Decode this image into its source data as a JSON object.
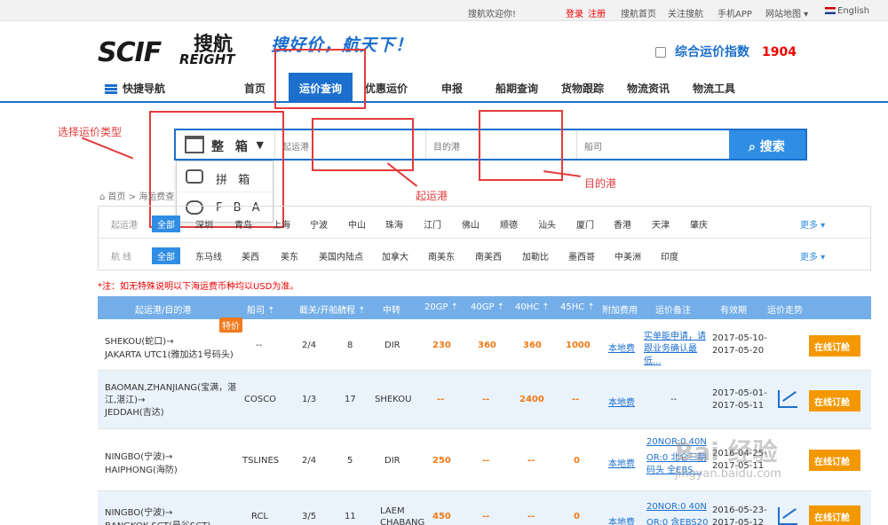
{
  "topbar": {
    "welcome": "搜航欢迎你!",
    "login": "登录",
    "register": "注册",
    "home": "搜航首页",
    "follow": "关注搜航",
    "app": "手机APP",
    "sitemap": "网站地图 ▾",
    "english": "English"
  },
  "logo": {
    "sc": "SCIF",
    "zh": "搜航",
    "en": "REIGHT"
  },
  "slogan": "搜好价，航天下！",
  "index": {
    "label": "综合运价指数",
    "value": "1904"
  },
  "nav": {
    "quick": "快捷导航",
    "items": [
      "首页",
      "运价查询",
      "优惠运价",
      "申报",
      "船期查询",
      "货物跟踪",
      "物流资讯",
      "物流工具"
    ]
  },
  "search": {
    "type": "整 箱",
    "from_label": "起运港",
    "to_label": "目的港",
    "carrier_label": "船司",
    "button": "搜索"
  },
  "dropdown": [
    "拼 箱",
    "F B A"
  ],
  "annotations": {
    "type": "选择运价类型",
    "from": "起运港",
    "to": "目的港"
  },
  "breadcrumb": "首页 > 海运费查",
  "filters": {
    "from_label": "起运港",
    "from_items": [
      "全部",
      "深圳",
      "青岛",
      "上海",
      "宁波",
      "中山",
      "珠海",
      "江门",
      "佛山",
      "顺德",
      "汕头",
      "厦门",
      "香港",
      "天津",
      "肇庆"
    ],
    "route_label": "航 线",
    "route_items": [
      "全部",
      "东马线",
      "美西",
      "美东",
      "美国内陆点",
      "加拿大",
      "南美东",
      "南美西",
      "加勒比",
      "墨西哥",
      "中美洲",
      "印度"
    ],
    "more": "更多 ▾"
  },
  "note": "*注：如无特殊说明以下海运费币种均以USD为准。",
  "table": {
    "headers": [
      "起运港/目的港",
      "船司 ⇡",
      "截关/开船 ⇡",
      "航程 ⇡",
      "中转",
      "20GP ⇡",
      "40GP ⇡",
      "40HC ⇡",
      "45HC ⇡",
      "附加费用",
      "运价备注",
      "有效期",
      "运价走势"
    ],
    "book": "在线订舱",
    "rows": [
      {
        "route1": "SHEKOU(蛇口)→",
        "route2": "JAKARTA UTC1(雅加达1号码头)",
        "route3": "",
        "tag": "特价",
        "carrier": "--",
        "cutoff": "2/4",
        "days": "8",
        "transit": "DIR",
        "gp20": "230",
        "gp40": "360",
        "hc40": "360",
        "hc45": "1000",
        "fee": "本地费",
        "remark1": "实单能申请，请",
        "remark2": "跟业务确认最",
        "remark3": "低...",
        "valid1": "2017-05-10-",
        "valid2": "2017-05-20"
      },
      {
        "route1": "BAOMAN,ZHANJIANG(宝满，湛",
        "route2": "江,湛江)→",
        "route3": "JEDDAH(吉达)",
        "tag": "",
        "carrier": "COSCO",
        "cutoff": "1/3",
        "days": "17",
        "transit": "SHEKOU",
        "gp20": "--",
        "gp40": "--",
        "hc40": "2400",
        "hc45": "--",
        "fee": "本地费",
        "remark1": "--",
        "remark2": "",
        "remark3": "",
        "valid1": "2017-05-01-",
        "valid2": "2017-05-11"
      },
      {
        "route1": "NINGBO(宁波)→",
        "route2": "HAIPHONG(海防)",
        "route3": "",
        "tag": "",
        "carrier": "TSLINES",
        "cutoff": "2/4",
        "days": "5",
        "transit": "DIR",
        "gp20": "250",
        "gp40": "--",
        "hc40": "--",
        "hc45": "0",
        "fee": "本地费",
        "remark1": "20NOR:0 40N",
        "remark2": "OR:0 北仑三期",
        "remark3": "码头 全EBS...",
        "valid1": "2016-04-25-",
        "valid2": "2017-05-11"
      },
      {
        "route1": "NINGBO(宁波)→",
        "route2": "BANGKOK SCT(曼谷SCT)",
        "route3": "",
        "tag": "",
        "carrier": "RCL",
        "cutoff": "3/5",
        "days": "11",
        "transit": "LAEM CHABANG",
        "gp20": "450",
        "gp40": "--",
        "hc40": "--",
        "hc45": "0",
        "fee": "本地费",
        "remark1": "20NOR:0 40N",
        "remark2": "OR:0 含EBS20",
        "remark3": "",
        "valid1": "2016-05-23-",
        "valid2": "2017-05-12"
      }
    ]
  },
  "watermark": {
    "main": "Bai 经验",
    "sub": "jingyan.baidu.com"
  }
}
